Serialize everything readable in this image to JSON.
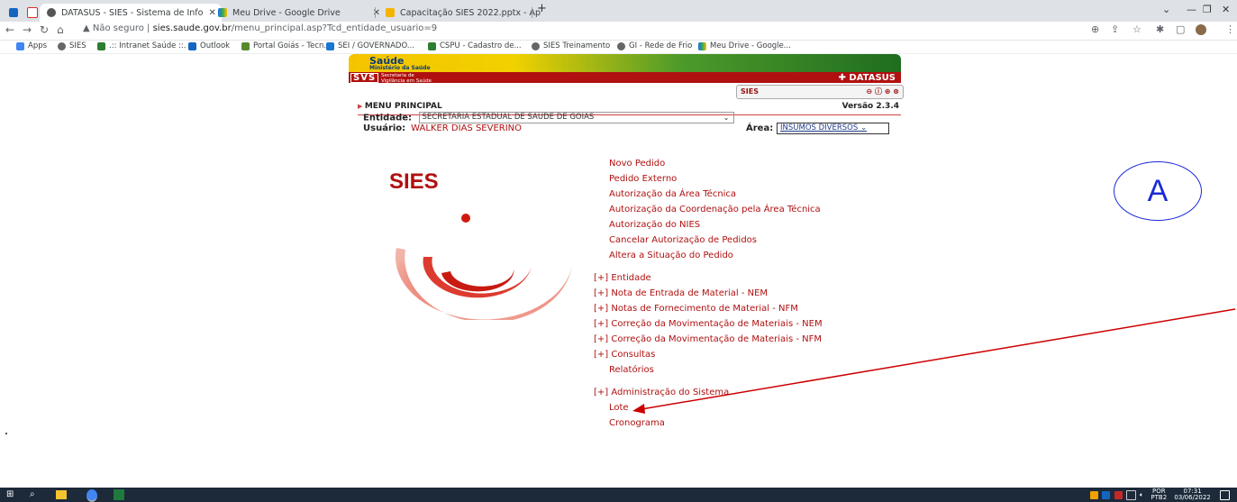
{
  "browser": {
    "tabs": [
      {
        "label": "DATASUS - SIES - Sistema de Info",
        "active": true
      },
      {
        "label": "Meu Drive - Google Drive",
        "active": false
      },
      {
        "label": "Capacitação SIES 2022.pptx - Ap",
        "active": false
      }
    ],
    "new_tab": "+",
    "url_warning": "Não seguro",
    "url_host": "sies.saude.gov.br",
    "url_path": "/menu_principal.asp?Tcd_entidade_usuario=9",
    "bookmarks": [
      "Apps",
      "SIES",
      ".:: Intranet Saúde ::.",
      "Outlook",
      "Portal Goiás - Tecn...",
      "SEI / GOVERNADO...",
      "CSPU - Cadastro de...",
      "SIES Treinamento",
      "GI - Rede de Frio",
      "Meu Drive - Google..."
    ]
  },
  "header": {
    "saude": "Saúde",
    "ministerio": "Ministério da Saúde",
    "svs": "SVS",
    "svs_sub_1": "Secretaria de",
    "svs_sub_2": "Vigilância em Saúde",
    "datasus": "DATASUS",
    "sies_small": "SIES"
  },
  "main": {
    "menu_title": "MENU PRINCIPAL",
    "versao": "Versão 2.3.4",
    "entidade_label": "Entidade:",
    "entidade_value": "SECRETARIA ESTADUAL DE SAUDE DE GOIAS",
    "usuario_label": "Usuário:",
    "usuario_value": "WALKER DIAS SEVERINO",
    "area_label": "Área:",
    "area_value": "INSUMOS DIVERSOS",
    "logo_text": "SIES"
  },
  "menu_links": [
    "Novo Pedido",
    "Pedido Externo",
    "Autorização da Área Técnica",
    "Autorização da Coordenação pela Área Técnica",
    "Autorização do NIES",
    "Cancelar Autorização de Pedidos",
    "Altera a Situação do Pedido"
  ],
  "menu_groups": [
    "[+] Entidade",
    "[+] Nota de Entrada de Material - NEM",
    "[+] Notas de Fornecimento de Material - NFM",
    "[+] Correção da Movimentação de Materiais - NEM",
    "[+] Correção da Movimentação de Materiais - NFM",
    "[+] Consultas"
  ],
  "menu_extra": {
    "relatorios": "Relatórios",
    "admin": "[+] Administração do Sistema",
    "lote": "Lote",
    "cronograma": "Cronograma"
  },
  "annotation": {
    "label": "A"
  },
  "taskbar": {
    "lang": "POR",
    "lang2": "PTB2",
    "time": "07:31",
    "date": "03/06/2022"
  },
  "colors": {
    "brand_red": "#b01010",
    "annotation_blue": "#1a2bd6"
  }
}
